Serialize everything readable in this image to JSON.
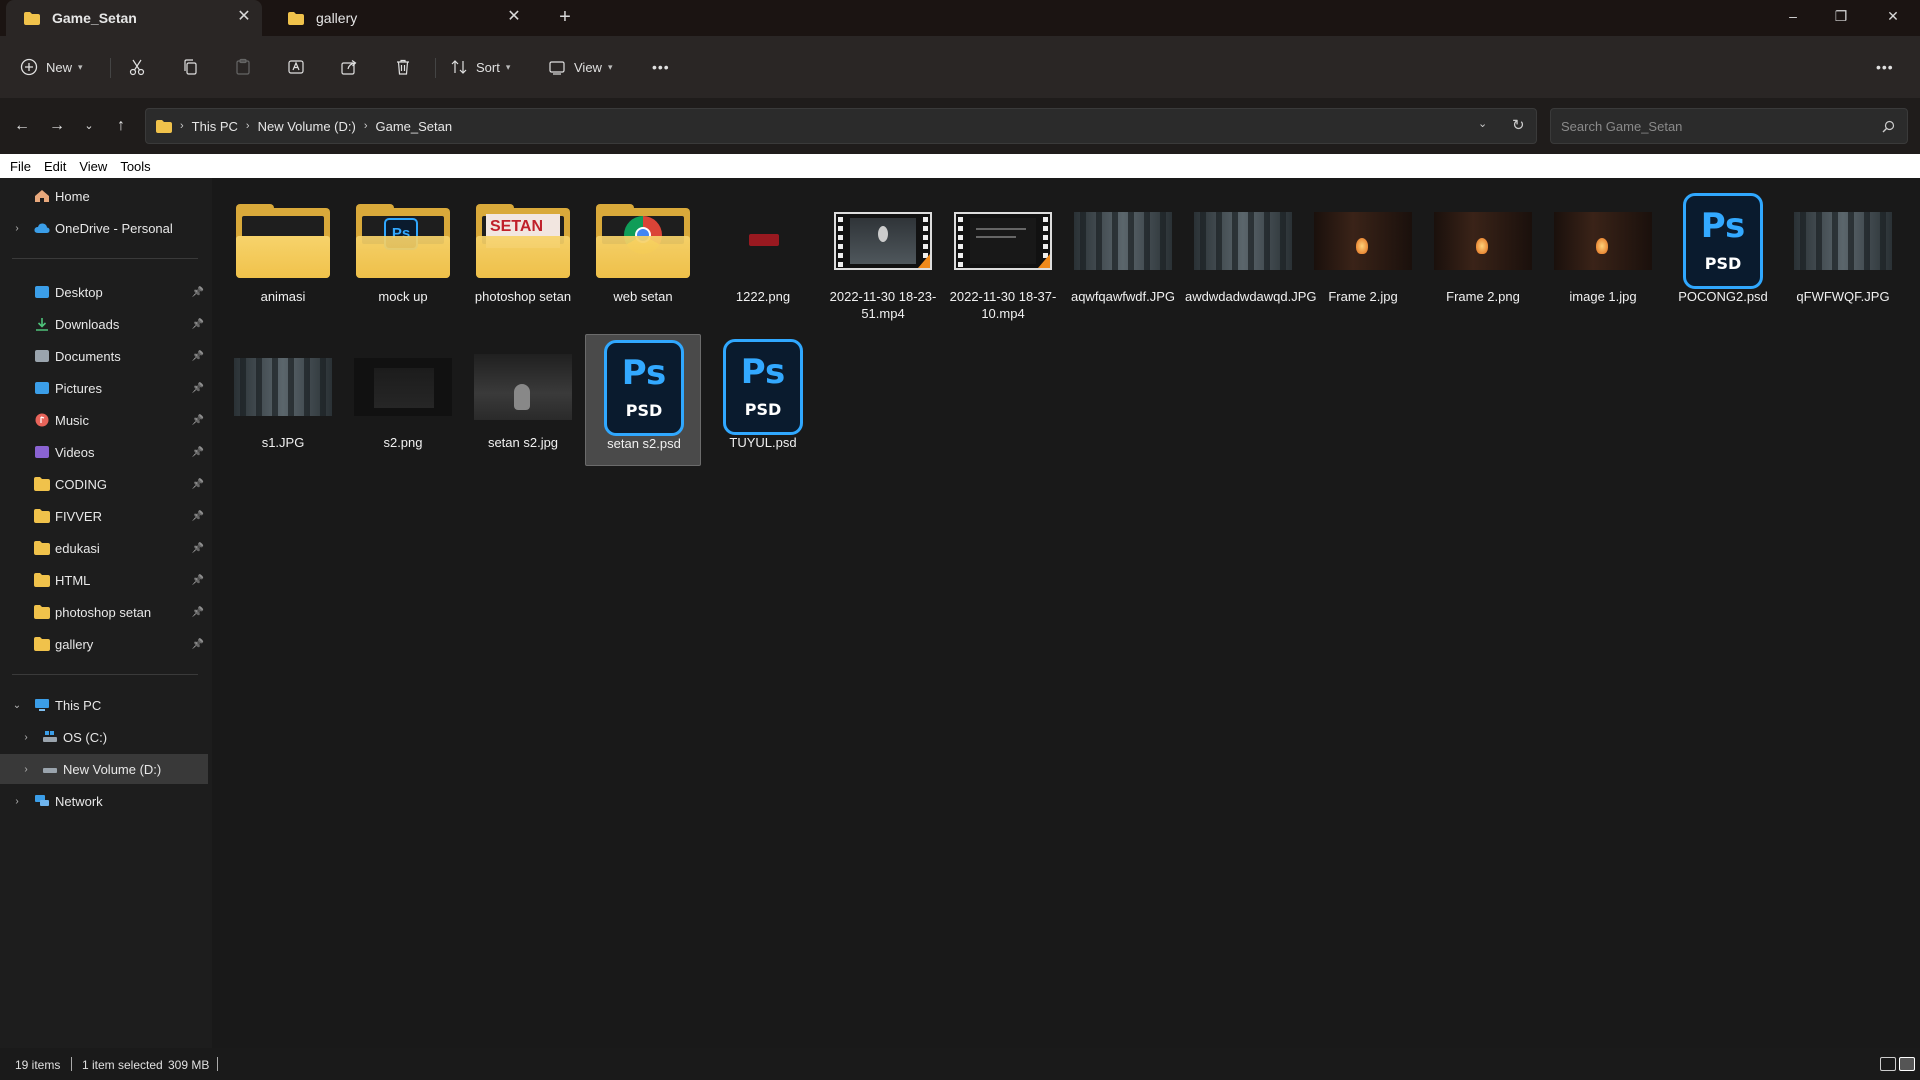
{
  "tabs": [
    {
      "label": "Game_Setan",
      "active": true
    },
    {
      "label": "gallery",
      "active": false
    }
  ],
  "window_controls": {
    "minimize": "–",
    "restore": "❐",
    "close": "✕"
  },
  "toolbar": {
    "new_label": "New",
    "sort_label": "Sort",
    "view_label": "View",
    "more": "•••"
  },
  "address": {
    "crumbs": [
      "This PC",
      "New Volume (D:)",
      "Game_Setan"
    ],
    "search_placeholder": "Search Game_Setan"
  },
  "menubar": [
    "File",
    "Edit",
    "View",
    "Tools"
  ],
  "sidebar": {
    "top": [
      {
        "label": "Home",
        "icon": "home-icon"
      },
      {
        "label": "OneDrive - Personal",
        "icon": "cloud-icon"
      }
    ],
    "quick_access": [
      {
        "label": "Desktop",
        "icon": "desktop-icon"
      },
      {
        "label": "Downloads",
        "icon": "download-icon"
      },
      {
        "label": "Documents",
        "icon": "document-icon"
      },
      {
        "label": "Pictures",
        "icon": "pictures-icon"
      },
      {
        "label": "Music",
        "icon": "music-icon"
      },
      {
        "label": "Videos",
        "icon": "videos-icon"
      },
      {
        "label": "CODING",
        "icon": "folder-icon"
      },
      {
        "label": "FIVVER",
        "icon": "folder-icon"
      },
      {
        "label": "edukasi",
        "icon": "folder-icon"
      },
      {
        "label": "HTML",
        "icon": "folder-icon"
      },
      {
        "label": "photoshop setan",
        "icon": "folder-icon"
      },
      {
        "label": "gallery",
        "icon": "folder-icon"
      }
    ],
    "this_pc": {
      "label": "This PC",
      "icon": "pc-icon"
    },
    "drives": [
      {
        "label": "OS (C:)",
        "icon": "drive-icon"
      },
      {
        "label": "New Volume (D:)",
        "icon": "drive-icon",
        "selected": true
      }
    ],
    "network": {
      "label": "Network",
      "icon": "network-icon"
    }
  },
  "files": [
    {
      "name": "animasi",
      "kind": "folder"
    },
    {
      "name": "mock up",
      "kind": "folder"
    },
    {
      "name": "photoshop setan",
      "kind": "folder"
    },
    {
      "name": "web setan",
      "kind": "folder"
    },
    {
      "name": "1222.png",
      "kind": "image"
    },
    {
      "name": "2022-11-30 18-23-51.mp4",
      "kind": "video"
    },
    {
      "name": "2022-11-30 18-37-10.mp4",
      "kind": "video"
    },
    {
      "name": "aqwfqawfwdf.JPG",
      "kind": "image"
    },
    {
      "name": "awdwdadwdawqd.JPG",
      "kind": "image"
    },
    {
      "name": "Frame 2.jpg",
      "kind": "image"
    },
    {
      "name": "Frame 2.png",
      "kind": "image"
    },
    {
      "name": "image 1.jpg",
      "kind": "image"
    },
    {
      "name": "POCONG2.psd",
      "kind": "psd"
    },
    {
      "name": "qFWFWQF.JPG",
      "kind": "image"
    },
    {
      "name": "s1.JPG",
      "kind": "image"
    },
    {
      "name": "s2.png",
      "kind": "image"
    },
    {
      "name": "setan s2.jpg",
      "kind": "image"
    },
    {
      "name": "setan s2.psd",
      "kind": "psd",
      "selected": true
    },
    {
      "name": "TUYUL.psd",
      "kind": "psd"
    }
  ],
  "psd_badge": {
    "ps": "Ps",
    "label": "PSD"
  },
  "status": {
    "count": "19 items",
    "selection": "1 item selected",
    "size": "309 MB"
  },
  "colors": {
    "accent": "#33a9ff",
    "folder": "#f0c24b",
    "selected_bg": "#4a4a4a"
  }
}
